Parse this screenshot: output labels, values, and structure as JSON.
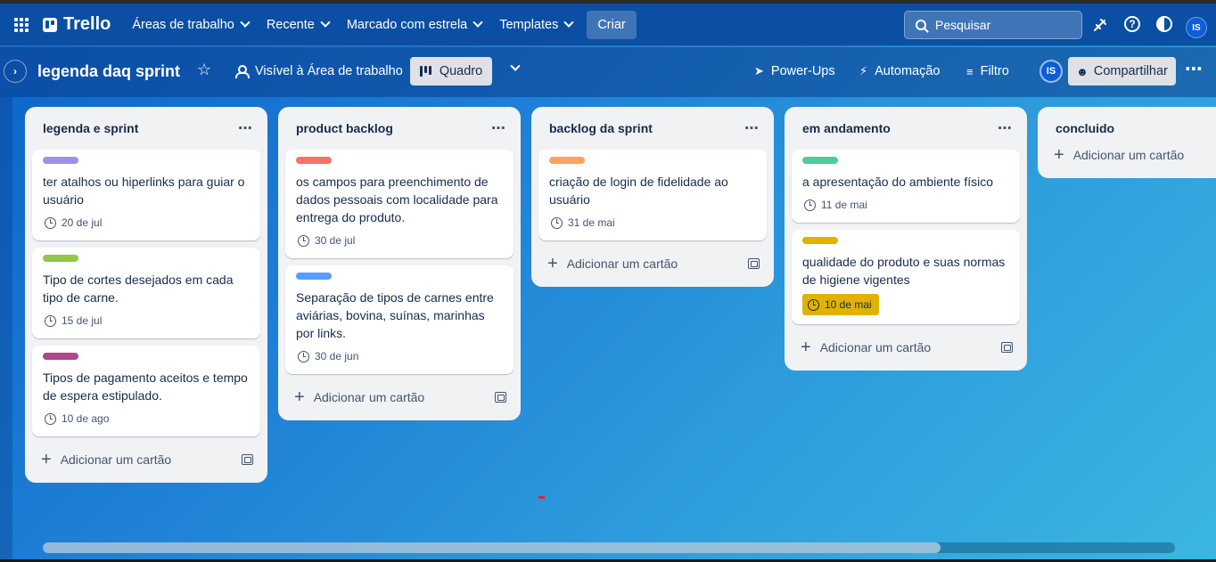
{
  "topnav": {
    "brand": "Trello",
    "menus": [
      "Áreas de trabalho",
      "Recente",
      "Marcado com estrela",
      "Templates"
    ],
    "create_label": "Criar",
    "search_placeholder": "Pesquisar",
    "avatar_initials": "IS"
  },
  "board": {
    "title": "legenda daq sprint",
    "visibility": "Visível à Área de trabalho",
    "view_label": "Quadro",
    "powerups": "Power-Ups",
    "automation": "Automação",
    "filter": "Filtro",
    "member_initials": "IS",
    "share_label": "Compartilhar"
  },
  "add_card_label": "Adicionar um cartão",
  "lists": [
    {
      "title": "legenda e sprint",
      "cards": [
        {
          "label_color": "#9f8fef",
          "text": "ter atalhos ou hiperlinks para guiar o usuário",
          "due": "20 de jul",
          "due_warning": false
        },
        {
          "label_color": "#94c748",
          "text": "Tipo de cortes desejados em cada tipo de carne.",
          "due": "15 de jul",
          "due_warning": false
        },
        {
          "label_color": "#ae4787",
          "text": "Tipos de pagamento aceitos e tempo de espera estipulado.",
          "due": "10 de ago",
          "due_warning": false
        }
      ]
    },
    {
      "title": "product backlog",
      "cards": [
        {
          "label_color": "#f87168",
          "text": "os campos para preenchimento de dados pessoais com localidade para entrega do produto.",
          "due": "30 de jul",
          "due_warning": false
        },
        {
          "label_color": "#579dff",
          "text": "Separação de tipos de carnes entre aviárias, bovina, suínas, marinhas por links.",
          "due": "30 de jun",
          "due_warning": false
        }
      ]
    },
    {
      "title": "backlog da sprint",
      "cards": [
        {
          "label_color": "#fea362",
          "text": "criação de login de fidelidade ao usuário",
          "due": "31 de mai",
          "due_warning": false
        }
      ]
    },
    {
      "title": "em andamento",
      "cards": [
        {
          "label_color": "#4bce97",
          "text": "a apresentação do ambiente físico",
          "due": "11 de mai",
          "due_warning": false
        },
        {
          "label_color": "#e2b203",
          "text": "qualidade do produto e suas normas de higiene vigentes",
          "due": "10 de mai",
          "due_warning": true
        }
      ]
    },
    {
      "title": "concluido",
      "cards": []
    }
  ]
}
